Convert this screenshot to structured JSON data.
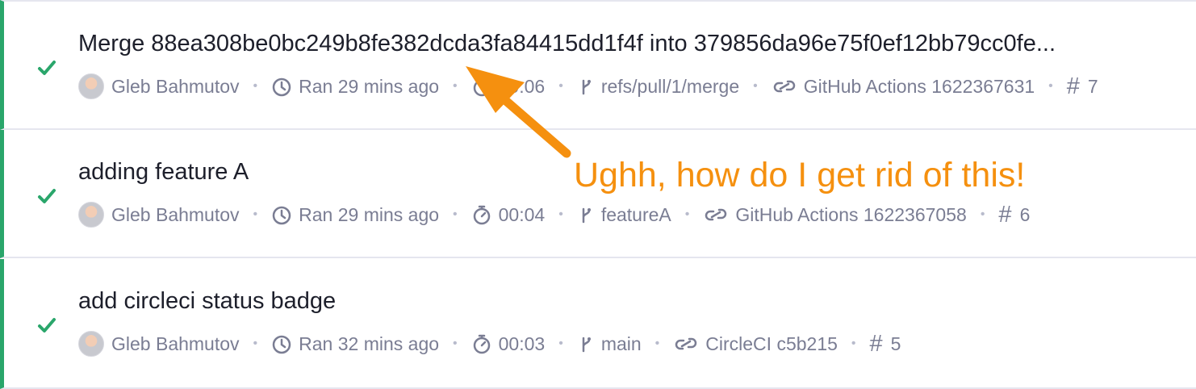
{
  "runs": [
    {
      "title": "Merge 88ea308be0bc249b8fe382dcda3fa84415dd1f4f into 379856da96e75f0ef12bb79cc0fe...",
      "author": "Gleb Bahmutov",
      "ran": "Ran 29 mins ago",
      "duration": "00:06",
      "branch": "refs/pull/1/merge",
      "ci": "GitHub Actions 1622367631",
      "number": "7",
      "status": "passed"
    },
    {
      "title": "adding feature A",
      "author": "Gleb Bahmutov",
      "ran": "Ran 29 mins ago",
      "duration": "00:04",
      "branch": "featureA",
      "ci": "GitHub Actions 1622367058",
      "number": "6",
      "status": "passed"
    },
    {
      "title": "add circleci status badge",
      "author": "Gleb Bahmutov",
      "ran": "Ran 32 mins ago",
      "duration": "00:03",
      "branch": "main",
      "ci": "CircleCI c5b215",
      "number": "5",
      "status": "passed"
    }
  ],
  "annotation": {
    "text": "Ughh, how do I get rid of this!",
    "color": "#f5900f"
  },
  "separator": "•",
  "colors": {
    "passed": "#2aa66b",
    "muted_text": "#7a7d93",
    "title_text": "#1d1f2b",
    "border": "#e5e6ef"
  },
  "icons": {
    "status": "check-icon",
    "ran": "clock-icon",
    "duration": "stopwatch-icon",
    "branch": "branch-icon",
    "ci": "link-icon",
    "number": "hash-icon"
  }
}
